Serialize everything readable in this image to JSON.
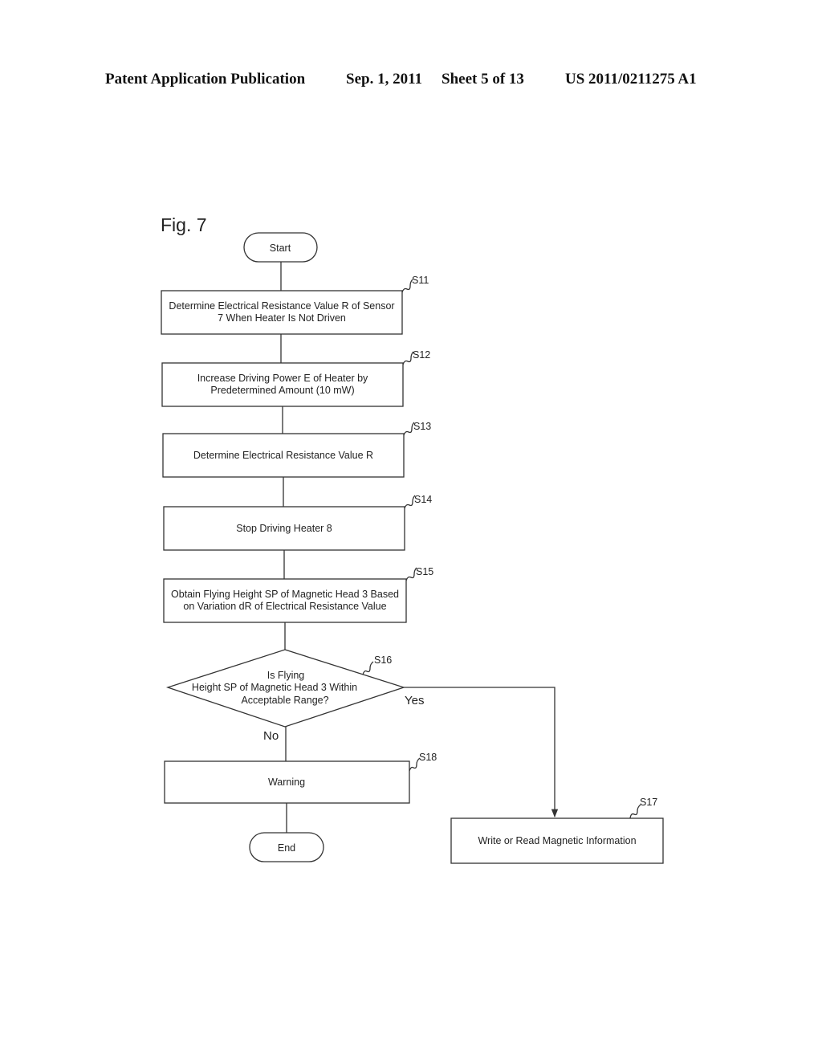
{
  "header": {
    "publication": "Patent Application Publication",
    "date": "Sep. 1, 2011",
    "sheet": "Sheet 5 of 13",
    "number": "US 2011/0211275 A1"
  },
  "figure": {
    "label": "Fig. 7",
    "start": "Start",
    "end": "End",
    "steps": [
      {
        "id": "S11",
        "lines": [
          "Determine Electrical Resistance Value R of Sensor",
          "7 When Heater Is Not Driven"
        ]
      },
      {
        "id": "S12",
        "lines": [
          "Increase Driving Power E of Heater by",
          "Predetermined Amount (10 mW)"
        ]
      },
      {
        "id": "S13",
        "lines": [
          "Determine Electrical Resistance Value R"
        ]
      },
      {
        "id": "S14",
        "lines": [
          "Stop Driving Heater 8"
        ]
      },
      {
        "id": "S15",
        "lines": [
          "Obtain Flying Height SP of Magnetic Head 3 Based",
          "on Variation dR of Electrical Resistance Value"
        ]
      },
      {
        "id": "S16",
        "lines": [
          "Is Flying",
          "Height SP of Magnetic Head 3 Within",
          "Acceptable Range?"
        ]
      },
      {
        "id": "S17",
        "lines": [
          "Write or Read Magnetic Information"
        ]
      },
      {
        "id": "S18",
        "lines": [
          "Warning"
        ]
      }
    ],
    "yes_label": "Yes",
    "no_label": "No"
  }
}
